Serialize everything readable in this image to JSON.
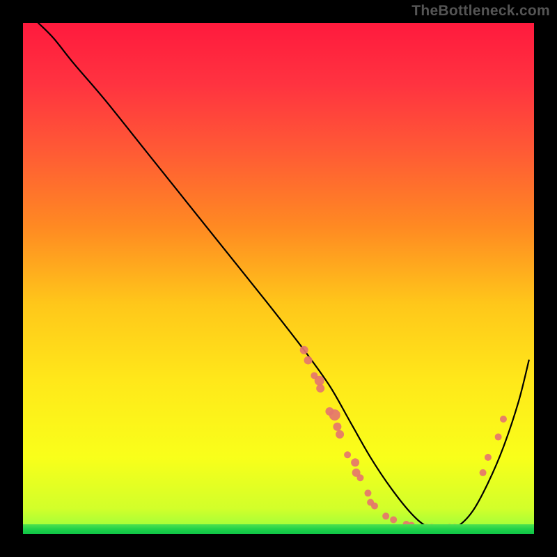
{
  "watermark": "TheBottleneck.com",
  "chart_data": {
    "type": "line",
    "title": "",
    "xlabel": "",
    "ylabel": "",
    "xlim": [
      0,
      100
    ],
    "ylim": [
      0,
      100
    ],
    "gradient_stops": [
      {
        "offset": 0,
        "color": "#ff1a3d"
      },
      {
        "offset": 12,
        "color": "#ff3340"
      },
      {
        "offset": 25,
        "color": "#ff5a35"
      },
      {
        "offset": 40,
        "color": "#ff8a22"
      },
      {
        "offset": 55,
        "color": "#ffc71a"
      },
      {
        "offset": 70,
        "color": "#ffe81a"
      },
      {
        "offset": 85,
        "color": "#f9ff1a"
      },
      {
        "offset": 95,
        "color": "#d2ff2a"
      },
      {
        "offset": 100,
        "color": "#8fff40"
      }
    ],
    "series": [
      {
        "name": "bottleneck-curve",
        "x": [
          3,
          6,
          10,
          16,
          24,
          32,
          40,
          48,
          55,
          60,
          64,
          68,
          72,
          76,
          79,
          82,
          85,
          88,
          91,
          94,
          97,
          99
        ],
        "y": [
          100,
          97,
          92,
          85,
          75,
          65,
          55,
          45,
          36,
          29,
          22,
          15,
          9,
          4,
          1.5,
          1,
          1.5,
          4.5,
          10,
          17,
          26,
          34
        ]
      }
    ],
    "scatter": {
      "name": "data-points",
      "color": "#e5766d",
      "points": [
        {
          "x": 55,
          "y": 36,
          "r": 6
        },
        {
          "x": 55.8,
          "y": 34,
          "r": 6
        },
        {
          "x": 57,
          "y": 31,
          "r": 5
        },
        {
          "x": 58,
          "y": 30,
          "r": 7
        },
        {
          "x": 58.2,
          "y": 28.5,
          "r": 6
        },
        {
          "x": 60,
          "y": 24,
          "r": 6
        },
        {
          "x": 61,
          "y": 23.3,
          "r": 8
        },
        {
          "x": 61.5,
          "y": 21,
          "r": 6
        },
        {
          "x": 62,
          "y": 19.5,
          "r": 6
        },
        {
          "x": 63.5,
          "y": 15.5,
          "r": 5
        },
        {
          "x": 65,
          "y": 14,
          "r": 6
        },
        {
          "x": 65.2,
          "y": 12,
          "r": 6
        },
        {
          "x": 66,
          "y": 11,
          "r": 5
        },
        {
          "x": 67.5,
          "y": 8,
          "r": 5
        },
        {
          "x": 68,
          "y": 6.2,
          "r": 5
        },
        {
          "x": 68.8,
          "y": 5.5,
          "r": 5
        },
        {
          "x": 71,
          "y": 3.5,
          "r": 5
        },
        {
          "x": 72.5,
          "y": 2.8,
          "r": 5
        },
        {
          "x": 75,
          "y": 1.9,
          "r": 5
        },
        {
          "x": 76,
          "y": 1.7,
          "r": 5
        },
        {
          "x": 79,
          "y": 1.3,
          "r": 5
        },
        {
          "x": 80,
          "y": 1.3,
          "r": 5
        },
        {
          "x": 83.5,
          "y": 1.3,
          "r": 5
        },
        {
          "x": 84.5,
          "y": 1.3,
          "r": 5
        },
        {
          "x": 90,
          "y": 12,
          "r": 5
        },
        {
          "x": 91,
          "y": 15,
          "r": 5
        },
        {
          "x": 93,
          "y": 19,
          "r": 5
        },
        {
          "x": 94,
          "y": 22.5,
          "r": 5
        }
      ]
    },
    "green_band_height_percent": 1.9
  }
}
